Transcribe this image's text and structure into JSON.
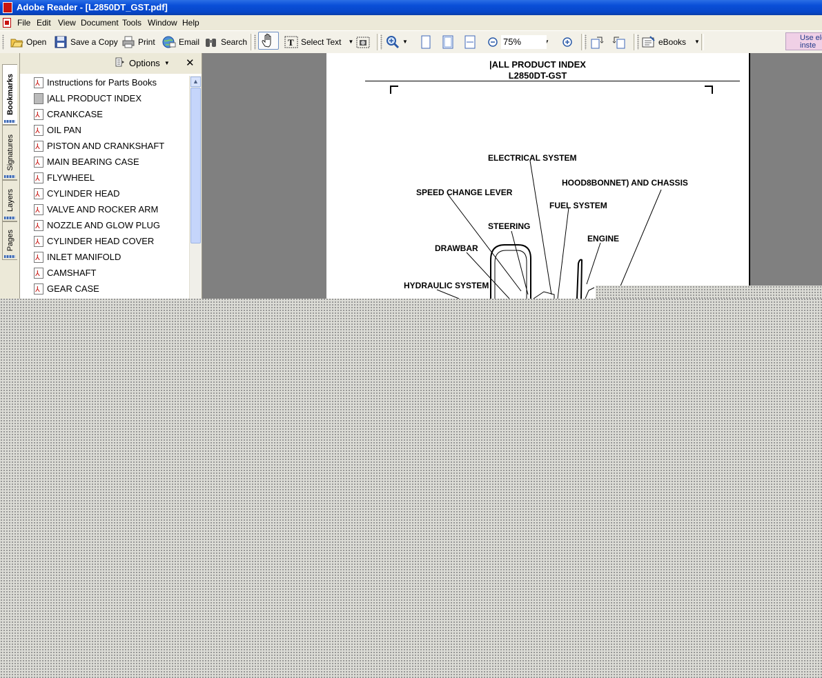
{
  "window": {
    "title": "Adobe Reader - [L2850DT_GST.pdf]"
  },
  "menubar": {
    "items": [
      "File",
      "Edit",
      "View",
      "Document",
      "Tools",
      "Window",
      "Help"
    ]
  },
  "toolbar": {
    "open": "Open",
    "save_copy": "Save a Copy",
    "print": "Print",
    "email": "Email",
    "search": "Search",
    "select_text": "Select Text",
    "zoom": "75%",
    "ebooks": "eBooks",
    "ad_text": "Use ele inste"
  },
  "side_tabs": [
    "Bookmarks",
    "Signatures",
    "Layers",
    "Pages"
  ],
  "bookmarks_panel": {
    "options_label": "Options",
    "items": [
      "Instructions for Parts Books",
      "|ALL PRODUCT INDEX",
      "CRANKCASE",
      "OIL PAN",
      "PISTON AND CRANKSHAFT",
      "MAIN BEARING CASE",
      "FLYWHEEL",
      "CYLINDER HEAD",
      "VALVE AND ROCKER ARM",
      "NOZZLE AND GLOW PLUG",
      "CYLINDER HEAD COVER",
      "INLET MANIFOLD",
      "CAMSHAFT",
      "GEAR CASE"
    ]
  },
  "document": {
    "header_line1": "|ALL PRODUCT INDEX",
    "header_line2": "L2850DT-GST",
    "labels": {
      "electrical": "ELECTRICAL SYSTEM",
      "hood": "HOOD8BONNET) AND CHASSIS",
      "speed": "SPEED CHANGE LEVER",
      "fuel": "FUEL SYSTEM",
      "steering": "STEERING",
      "engine": "ENGINE",
      "drawbar": "DRAWBAR",
      "hydraulic": "HYDRAULIC SYSTEM"
    }
  }
}
